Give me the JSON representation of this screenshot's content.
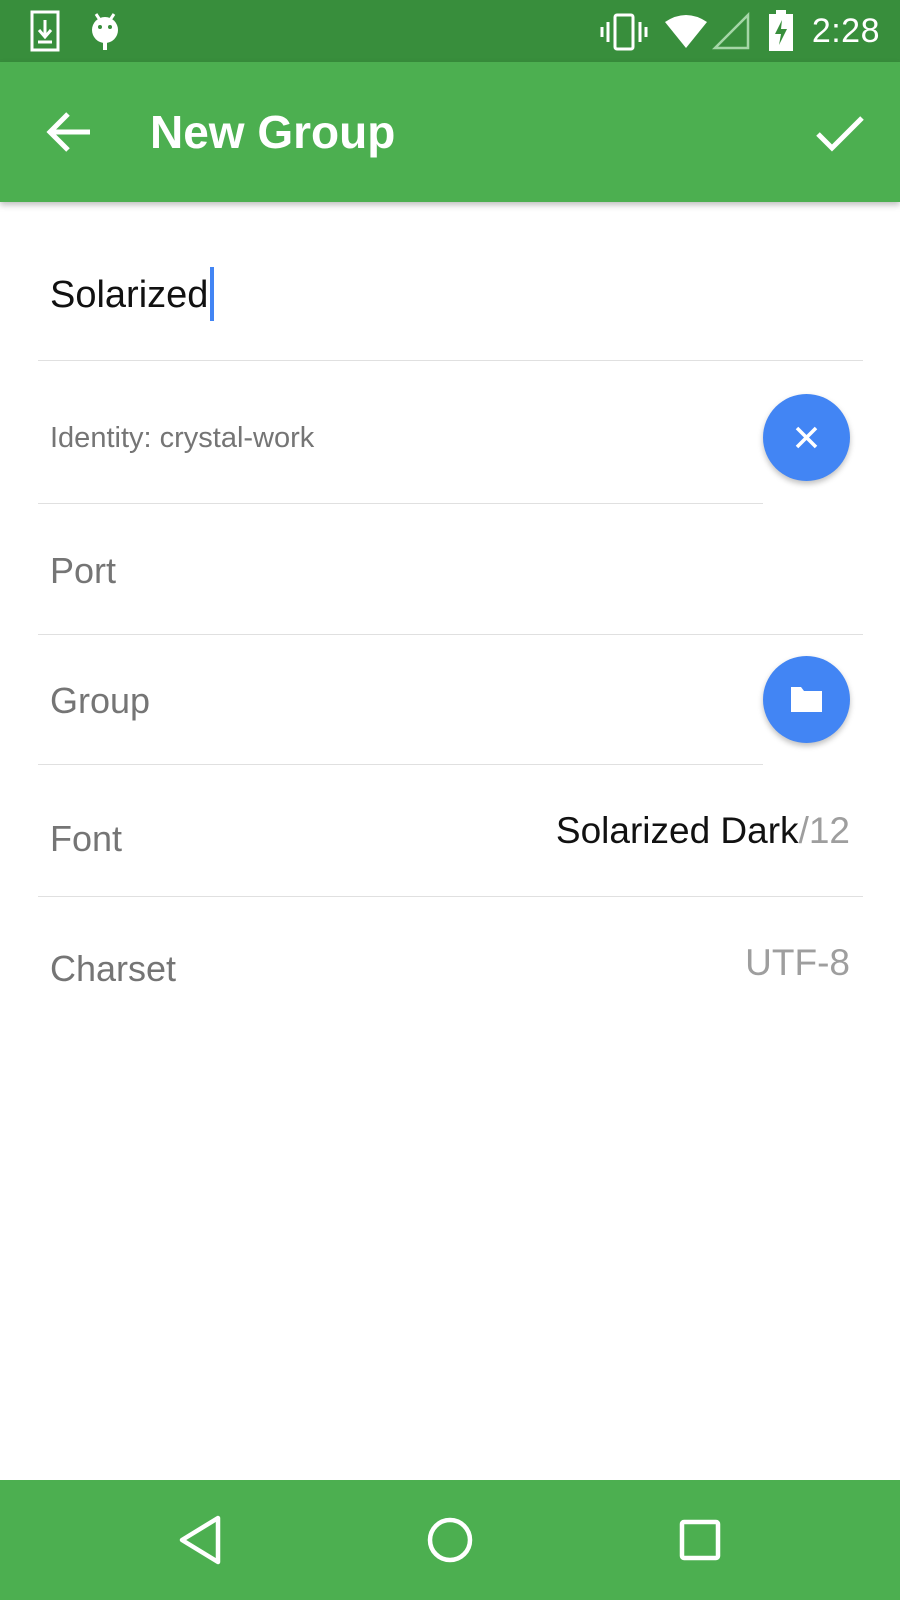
{
  "status_bar": {
    "time": "2:28",
    "icons": [
      "download-icon",
      "android-debug-icon",
      "vibrate-icon",
      "wifi-icon",
      "no-signal-icon",
      "battery-charging-icon"
    ]
  },
  "app_bar": {
    "title": "New Group",
    "back_icon": "arrow-back-icon",
    "confirm_icon": "check-icon"
  },
  "form": {
    "name_value": "Solarized",
    "identity_label": "Identity: crystal-work",
    "identity_clear_icon": "close-icon",
    "port_placeholder": "Port",
    "group_placeholder": "Group",
    "group_pick_icon": "folder-icon",
    "font_label": "Font",
    "font_value": "Solarized Dark",
    "font_size": "/12",
    "charset_label": "Charset",
    "charset_value": "UTF-8"
  },
  "colors": {
    "status_bar": "#388e3c",
    "app_bar": "#4caf50",
    "accent": "#4285f4"
  },
  "nav_bar": {
    "icons": [
      "back-triangle-icon",
      "home-circle-icon",
      "recents-square-icon"
    ]
  }
}
